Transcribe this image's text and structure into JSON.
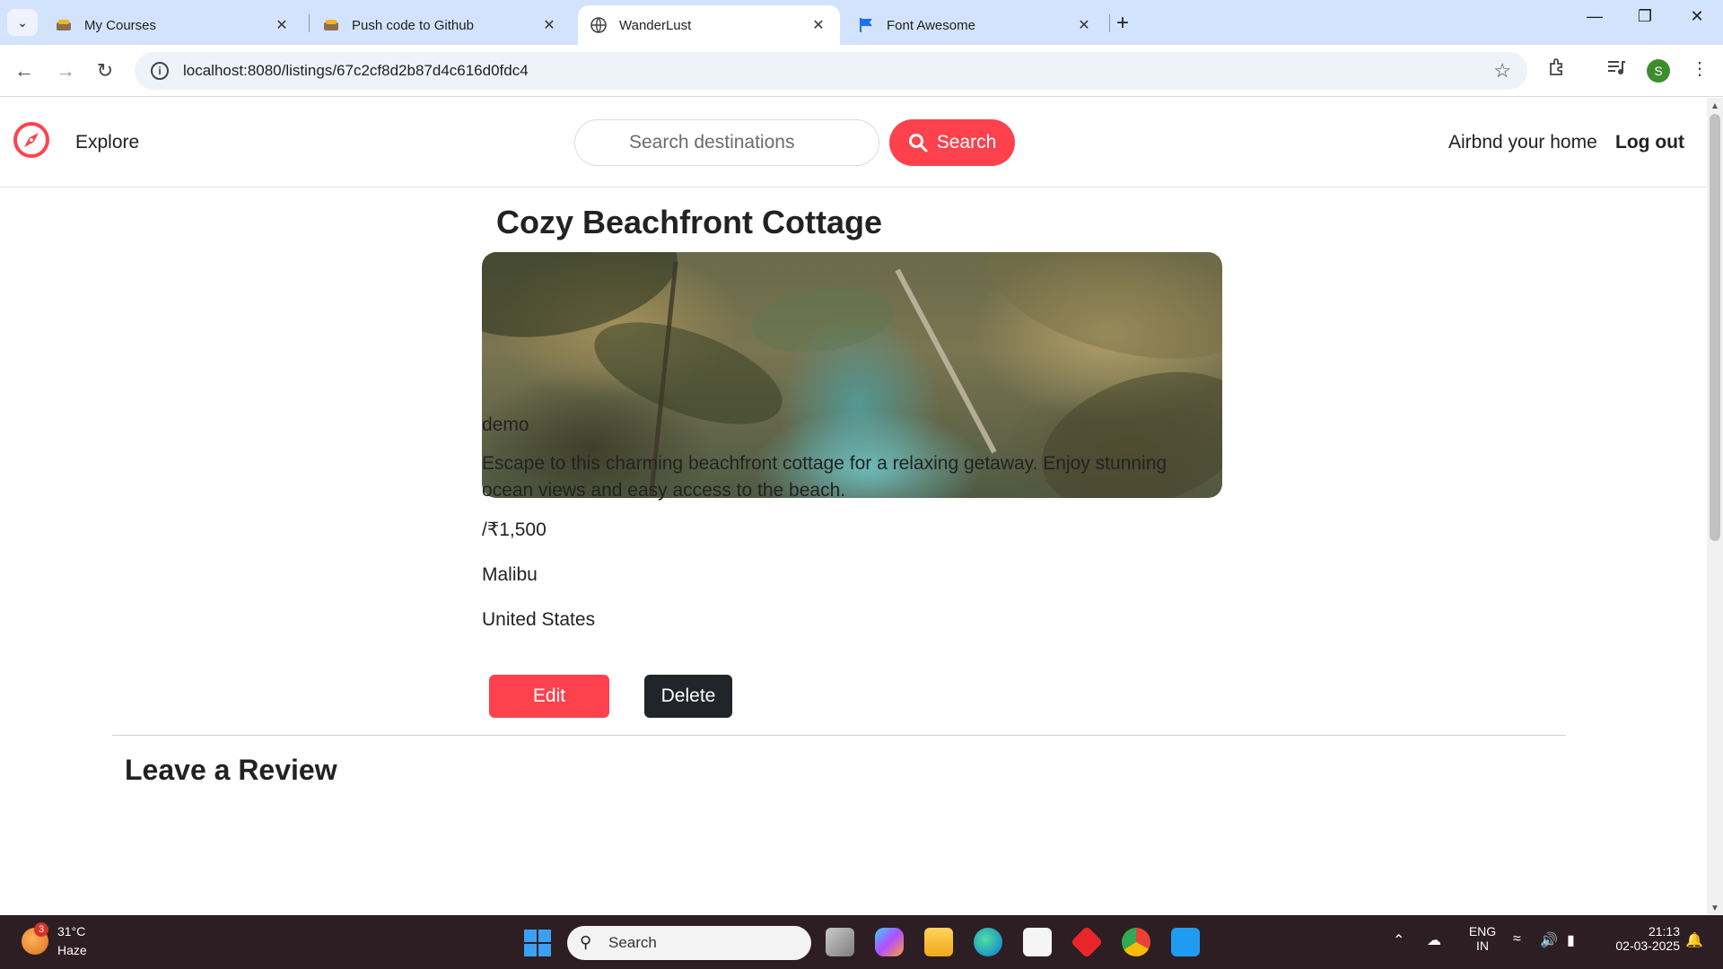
{
  "browser": {
    "tabs": [
      {
        "title": "My Courses",
        "icon": "course-icon",
        "active": false
      },
      {
        "title": "Push code to Github",
        "icon": "course-icon",
        "active": false
      },
      {
        "title": "WanderLust",
        "icon": "globe-icon",
        "active": true
      },
      {
        "title": "Font Awesome",
        "icon": "flag-icon",
        "active": false
      }
    ],
    "url": "localhost:8080/listings/67c2cf8d2b87d4c616d0fdc4",
    "profile_initial": "S",
    "accent": "#d3e3fd"
  },
  "site": {
    "nav": {
      "explore": "Explore",
      "search_placeholder": "Search destinations",
      "search_button": "Search",
      "airbnb_link": "Airbnd your home",
      "logout": "Log out"
    },
    "brand_color": "#fe424d"
  },
  "listing": {
    "title": "Cozy Beachfront Cottage",
    "owner": "demo",
    "description": "Escape to this charming beachfront cottage for a relaxing getaway. Enjoy stunning ocean views and easy access to the beach.",
    "price": "/₹1,500",
    "location": "Malibu",
    "country": "United States",
    "edit_button": "Edit",
    "delete_button": "Delete",
    "review_heading": "Leave a Review"
  },
  "taskbar": {
    "weather_badge": "3",
    "temperature": "31°C",
    "condition": "Haze",
    "search_label": "Search",
    "lang_line1": "ENG",
    "lang_line2": "IN",
    "time": "21:13",
    "date": "02-03-2025"
  }
}
